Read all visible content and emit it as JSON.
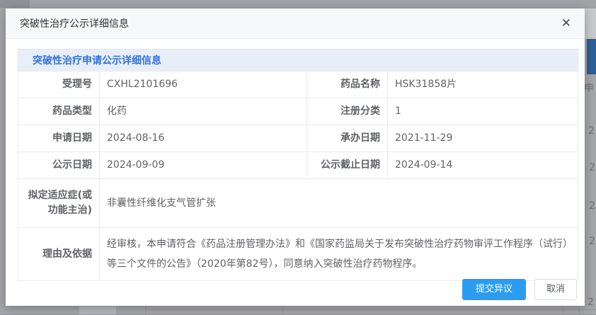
{
  "dialog": {
    "title": "突破性治疗公示详细信息",
    "close_glyph": "✕",
    "section_title": "突破性治疗申请公示详细信息"
  },
  "table": {
    "rows": [
      {
        "label1": "受理号",
        "value1": "CXHL2101696",
        "label2": "药品名称",
        "value2": "HSK31858片"
      },
      {
        "label1": "药品类型",
        "value1": "化药",
        "label2": "注册分类",
        "value2": "1"
      },
      {
        "label1": "申请日期",
        "value1": "2024-08-16",
        "label2": "承办日期",
        "value2": "2021-11-29"
      },
      {
        "label1": "公示日期",
        "value1": "2024-09-09",
        "label2": "公示截止日期",
        "value2": "2024-09-14"
      }
    ],
    "full_rows": [
      {
        "label": "拟定适应症(或功能主治)",
        "value": "非囊性纤维化支气管扩张"
      },
      {
        "label": "理由及依据",
        "value": "经审核，本申请符合《药品注册管理办法》和《国家药监局关于发布突破性治疗药物审评工作程序（试行）等三个文件的公告》（2020年第82号），同意纳入突破性治疗药物程序。"
      }
    ]
  },
  "footer": {
    "submit_label": "提交异议",
    "cancel_label": "取消"
  },
  "background": {
    "fragments": [
      "申",
      "2",
      "2",
      "2",
      "2",
      "2"
    ]
  },
  "colors": {
    "primary_button": "#2b9df0",
    "section_text": "#3273d8",
    "section_bg": "#e8eef8",
    "overlay": "#a5a6aa",
    "background_header_blue": "#2d5f97"
  }
}
